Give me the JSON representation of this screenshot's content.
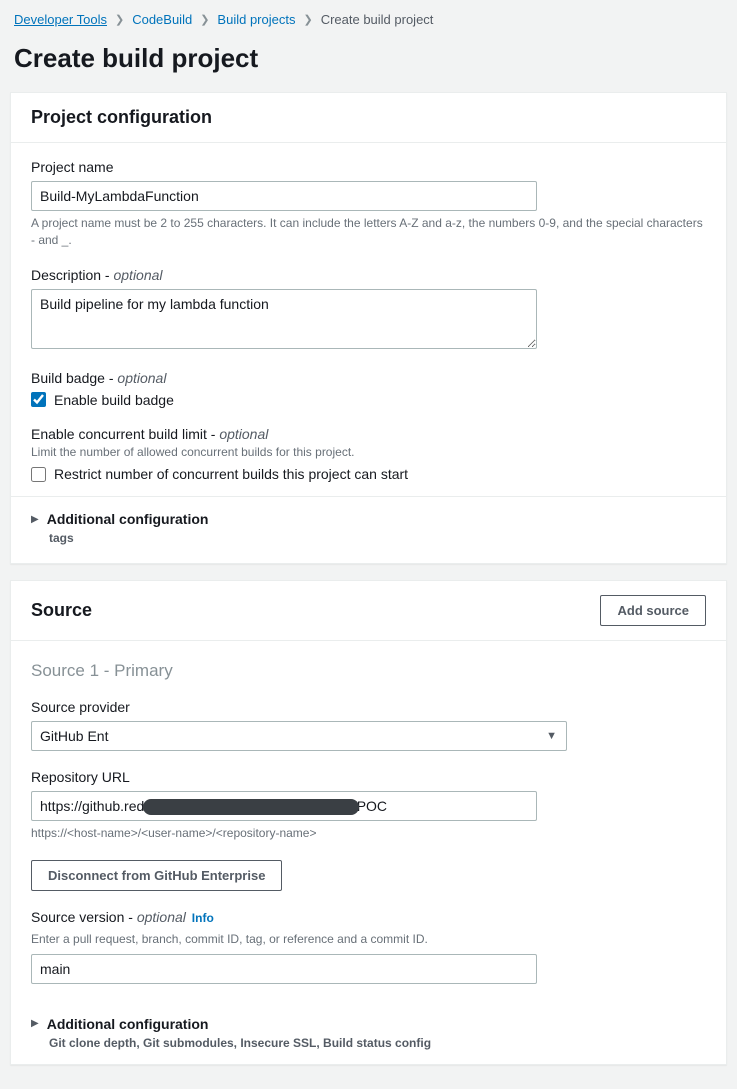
{
  "breadcrumb": {
    "items": [
      "Developer Tools",
      "CodeBuild",
      "Build projects",
      "Create build project"
    ]
  },
  "page_title": "Create build project",
  "project_config": {
    "header": "Project configuration",
    "name_label": "Project name",
    "name_value": "Build-MyLambdaFunction",
    "name_help": "A project name must be 2 to 255 characters. It can include the letters A-Z and a-z, the numbers 0-9, and the special characters - and _.",
    "desc_label": "Description",
    "desc_value": "Build pipeline for my lambda function",
    "badge_label": "Build badge",
    "badge_checkbox": "Enable build badge",
    "concurrent_label": "Enable concurrent build limit",
    "concurrent_help": "Limit the number of allowed concurrent builds for this project.",
    "concurrent_checkbox": "Restrict number of concurrent builds this project can start",
    "additional_title": "Additional configuration",
    "additional_sub": "tags",
    "optional": "optional"
  },
  "source": {
    "header": "Source",
    "add_button": "Add source",
    "subheader": "Source 1 - Primary",
    "provider_label": "Source provider",
    "provider_value": "GitHub Enterprise",
    "repo_label": "Repository URL",
    "repo_value": "https://github.redacted.example/ABCD-Exa-GHIJK/POC",
    "repo_help": "https://<host-name>/<user-name>/<repository-name>",
    "disconnect_button": "Disconnect from GitHub Enterprise",
    "version_label": "Source version",
    "version_info": "Info",
    "version_help": "Enter a pull request, branch, commit ID, tag, or reference and a commit ID.",
    "version_value": "main",
    "additional_title": "Additional configuration",
    "additional_sub": "Git clone depth, Git submodules, Insecure SSL, Build status config",
    "optional": "optional"
  }
}
